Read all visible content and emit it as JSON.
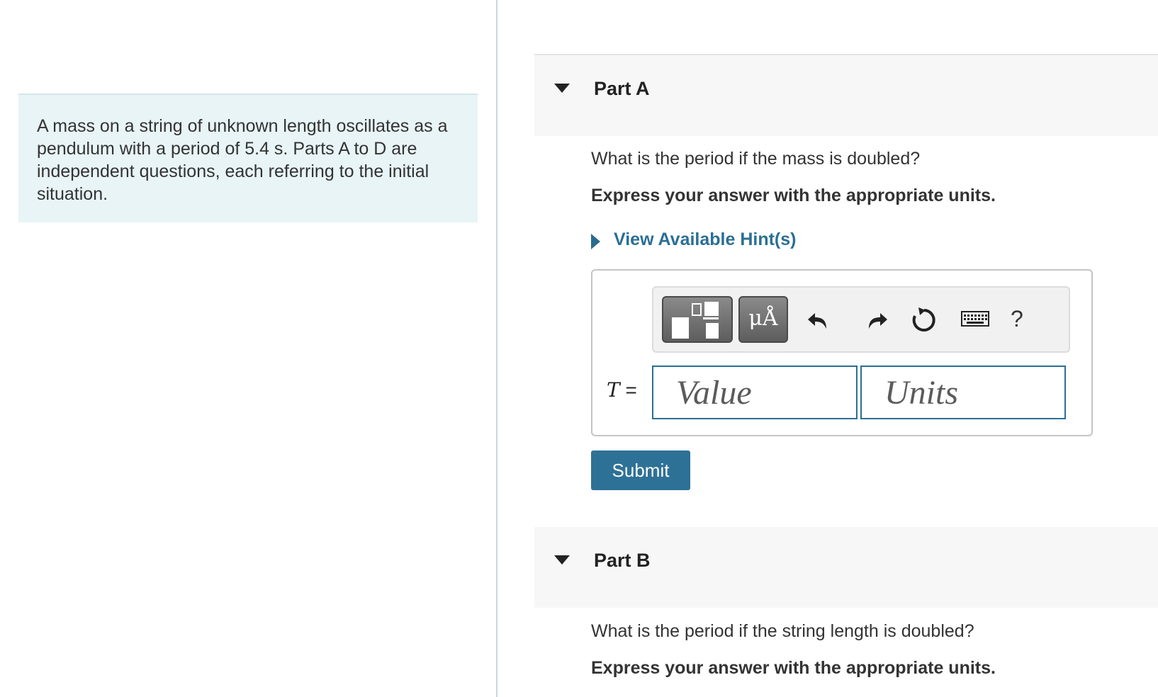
{
  "problem": {
    "text": "A mass on a string of unknown length oscillates as a pendulum with a period of 5.4 s. Parts A to D are independent questions, each referring to the initial situation."
  },
  "parts": [
    {
      "title": "Part A",
      "question": "What is the period if the mass is doubled?",
      "instruction": "Express your answer with the appropriate units.",
      "hint_link": "View Available Hint(s)",
      "answer": {
        "variable": "T",
        "equals": " =",
        "value_placeholder": "Value",
        "units_placeholder": "Units",
        "value": "",
        "units": ""
      },
      "toolbar": {
        "units_button": "μÅ",
        "help": "?",
        "icons": [
          "templates-icon",
          "units-icon",
          "undo-icon",
          "redo-icon",
          "reset-icon",
          "keyboard-icon",
          "help-icon"
        ]
      },
      "submit_label": "Submit"
    },
    {
      "title": "Part B",
      "question": "What is the period if the string length is doubled?",
      "instruction": "Express your answer with the appropriate units."
    }
  ],
  "colors": {
    "problem_bg": "#e8f4f6",
    "link": "#2b6f94",
    "submit_bg": "#2e7196",
    "header_bg": "#f7f7f7"
  }
}
